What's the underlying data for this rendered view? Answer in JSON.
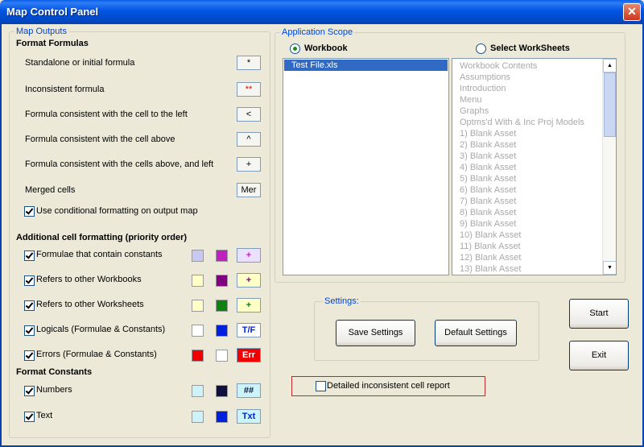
{
  "window": {
    "title": "Map Control Panel"
  },
  "map_outputs": {
    "legend": "Map Outputs",
    "format_formulas_header": "Format Formulas",
    "formula_rows": [
      {
        "label": "Standalone or initial formula",
        "button": "*",
        "color": "#000000"
      },
      {
        "label": "Inconsistent formula",
        "button": "**",
        "color": "#E00000"
      },
      {
        "label": "Formula consistent with the cell to the left",
        "button": "<",
        "color": "#000000"
      },
      {
        "label": "Formula consistent with the cell above",
        "button": "^",
        "color": "#000000"
      },
      {
        "label": "Formula consistent with the cells above, and  left",
        "button": "+",
        "color": "#000000"
      },
      {
        "label": "Merged cells",
        "button": "Mer",
        "color": "#000000"
      }
    ],
    "conditional_formatting_label": "Use conditional formatting on output map",
    "additional_header": "Additional cell formatting (priority order)",
    "additional_rows": [
      {
        "label": "Formulae that contain constants",
        "checked": true,
        "swatch1": "#C8C8F0",
        "swatch2": "#C020C0",
        "button": "+",
        "btn_bg": "#EAE0FF",
        "btn_fg": "#C020C0"
      },
      {
        "label": "Refers to other Workbooks",
        "checked": true,
        "swatch1": "#FFFFC8",
        "swatch2": "#800080",
        "button": "+",
        "btn_bg": "#FFFFC8",
        "btn_fg": "#800080"
      },
      {
        "label": "Refers to other Worksheets",
        "checked": true,
        "swatch1": "#FFFFC8",
        "swatch2": "#108010",
        "button": "+",
        "btn_bg": "#FFFFC8",
        "btn_fg": "#108010"
      },
      {
        "label": "Logicals (Formulae & Constants)",
        "checked": true,
        "swatch1": "#FFFFFF",
        "swatch2": "#0020E0",
        "button": "T/F",
        "btn_bg": "#FFFFFF",
        "btn_fg": "#0020E0"
      },
      {
        "label": "Errors (Formulae & Constants)",
        "checked": true,
        "swatch1": "#F00000",
        "swatch2": "#FFFFFF",
        "button": "Err",
        "btn_bg": "#F00000",
        "btn_fg": "#FFFFFF"
      }
    ],
    "format_constants_header": "Format Constants",
    "constant_rows": [
      {
        "label": "Numbers",
        "checked": true,
        "swatch1": "#CCF4F8",
        "swatch2": "#101040",
        "button": "##",
        "btn_bg": "#CCF4F8",
        "btn_fg": "#101040"
      },
      {
        "label": "Text",
        "checked": true,
        "swatch1": "#CCF4F8",
        "swatch2": "#0020E0",
        "button": "Txt",
        "btn_bg": "#CCF4F8",
        "btn_fg": "#0020E0"
      }
    ]
  },
  "scope": {
    "legend": "Application Scope",
    "workbook_label": "Workbook",
    "worksheets_label": "Select WorkSheets",
    "workbook_items": [
      "Test File.xls"
    ],
    "worksheet_items": [
      "Workbook Contents",
      "Assumptions",
      "Introduction",
      "Menu",
      "Graphs",
      "Optms'd With & Inc Proj Models",
      "1) Blank Asset",
      "2) Blank Asset",
      "3) Blank Asset",
      "4) Blank Asset",
      "5) Blank Asset",
      "6) Blank Asset",
      "7) Blank Asset",
      "8) Blank Asset",
      "9) Blank Asset",
      "10) Blank Asset",
      "11) Blank Asset",
      "12) Blank Asset",
      "13) Blank Asset"
    ]
  },
  "settings": {
    "legend": "Settings:",
    "save_label": "Save Settings",
    "default_label": "Default  Settings"
  },
  "actions": {
    "start_label": "Start",
    "exit_label": "Exit"
  },
  "report": {
    "label": "Detailed inconsistent cell report",
    "checked": false
  }
}
